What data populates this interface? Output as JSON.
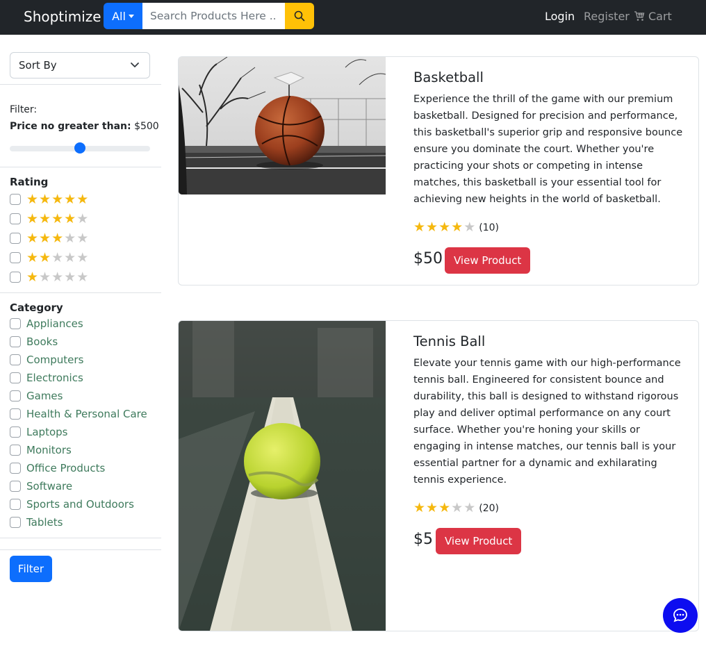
{
  "navbar": {
    "brand": "Shoptimize",
    "category_button": "All",
    "search_placeholder": "Search Products Here ...",
    "login": "Login",
    "register": "Register",
    "cart": "Cart"
  },
  "sidebar": {
    "sort_label": "Sort By",
    "filter_label": "Filter:",
    "price_label": "Price no greater than:",
    "price_value": "$500",
    "price_slider_fraction": 0.5,
    "rating_title": "Rating",
    "ratings": [
      5,
      4,
      3,
      2,
      1
    ],
    "category_title": "Category",
    "categories": [
      "Appliances",
      "Books",
      "Computers",
      "Electronics",
      "Games",
      "Health & Personal Care",
      "Laptops",
      "Monitors",
      "Office Products",
      "Software",
      "Sports and Outdoors",
      "Tablets"
    ],
    "filter_button": "Filter"
  },
  "products": [
    {
      "title": "Basketball",
      "description": "Experience the thrill of the game with our premium basketball. Designed for precision and performance, this basketball's superior grip and responsive bounce ensure you dominate the court. Whether you're practicing your shots or competing in intense matches, this basketball is your essential tool for achieving new heights in the world of basketball.",
      "rating": 4,
      "rating_count": "(10)",
      "price": "$50",
      "button": "View Product"
    },
    {
      "title": "Tennis Ball",
      "description": "Elevate your tennis game with our high-performance tennis ball. Engineered for consistent bounce and durability, this ball is designed to withstand rigorous play and deliver optimal performance on any court surface. Whether you're honing your skills or engaging in intense matches, our tennis ball is your essential partner for a dynamic and exhilarating tennis experience.",
      "rating": 3,
      "rating_count": "(20)",
      "price": "$5",
      "button": "View Product"
    }
  ],
  "colors": {
    "star_filled": "#f5b80f",
    "star_empty": "#c8c8c8",
    "primary": "#0d6efd",
    "danger": "#dc3545",
    "warning": "#ffc107",
    "navbar": "#212529",
    "category_text": "#3e7a5c"
  },
  "icons": {
    "search": "search-icon",
    "cart": "cart-icon",
    "chat": "chat-icon",
    "chevron": "chevron-down-icon"
  }
}
